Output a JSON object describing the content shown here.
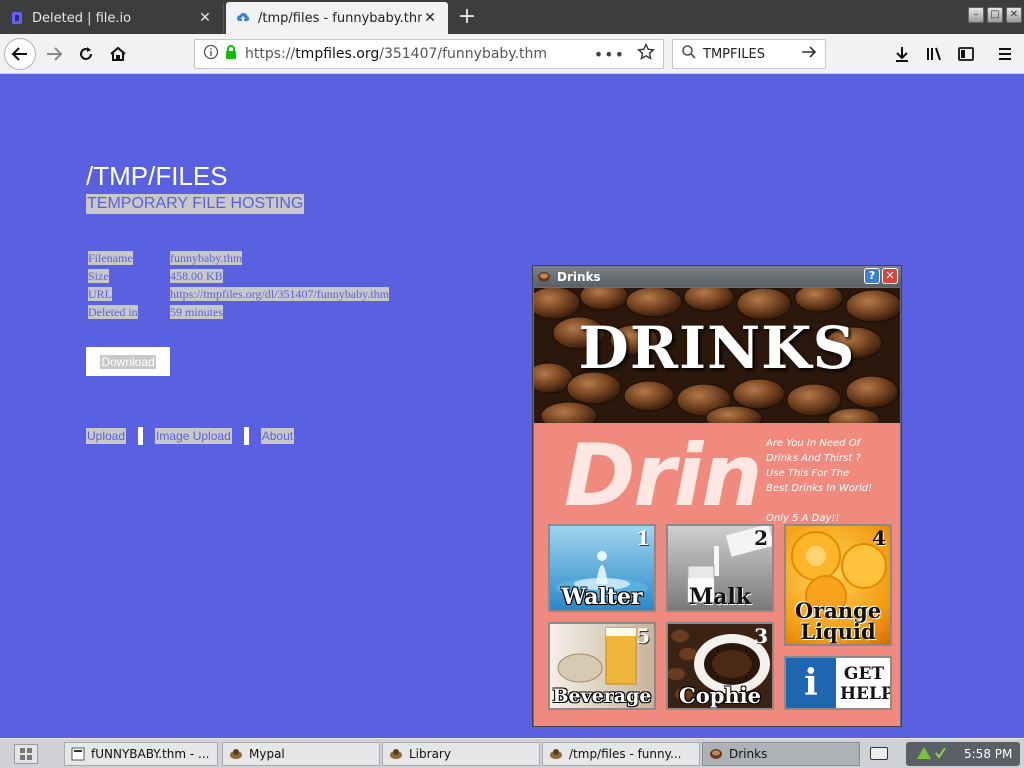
{
  "browser": {
    "tabs": [
      {
        "label": "Deleted | file.io",
        "icon": "fileio-icon",
        "active": false
      },
      {
        "label": "/tmp/files - funnybaby.thm",
        "icon": "cloud-upload-icon",
        "active": true
      }
    ],
    "url": {
      "prefix": "https://",
      "host": "tmpfiles.org",
      "path": "/351407/funnybaby.thm"
    },
    "search": {
      "value": "TMPFILES"
    }
  },
  "page": {
    "title": "/TMP/FILES",
    "subtitle": "TEMPORARY FILE HOSTING",
    "info": [
      {
        "key": "Filename",
        "value": "funnybaby.thm"
      },
      {
        "key": "Size",
        "value": "458.00 KB"
      },
      {
        "key": "URL",
        "value": "https://tmpfiles.org/dl/351407/funnybaby.thm"
      },
      {
        "key": "Deleted in",
        "value": "59 minutes"
      }
    ],
    "download_label": "Download",
    "links": [
      "Upload",
      "Image Upload",
      "About"
    ]
  },
  "drinks_window": {
    "title": "Drinks",
    "banner_title": "DRINKS",
    "big_text": "Drinks",
    "tagline": [
      "Are You In Need Of",
      "Drinks And Thirst ?",
      "Use This For The",
      "Best Drinks In World!",
      "",
      "Only 5 A Day!!"
    ],
    "tiles": [
      {
        "number": "1",
        "caption": "Walter"
      },
      {
        "number": "2",
        "caption": "Malk"
      },
      {
        "number": "4",
        "caption": "Orange Liquid"
      },
      {
        "number": "5",
        "caption": "Beverage"
      },
      {
        "number": "3",
        "caption": "Cophie"
      },
      {
        "number": "",
        "caption": "GET HELP",
        "icon": "info-icon"
      }
    ]
  },
  "taskbar": {
    "tasks": [
      {
        "label": "fUNNYBABY.thm - ..."
      },
      {
        "label": "Mypal"
      },
      {
        "label": "Library"
      },
      {
        "label": "/tmp/files - funny..."
      },
      {
        "label": "Drinks"
      }
    ],
    "clock": "5:58 PM"
  },
  "colors": {
    "page_bg": "#5a61e0",
    "drinks_bg": "#f18a7e",
    "tab_bar": "#3d3d3d"
  }
}
